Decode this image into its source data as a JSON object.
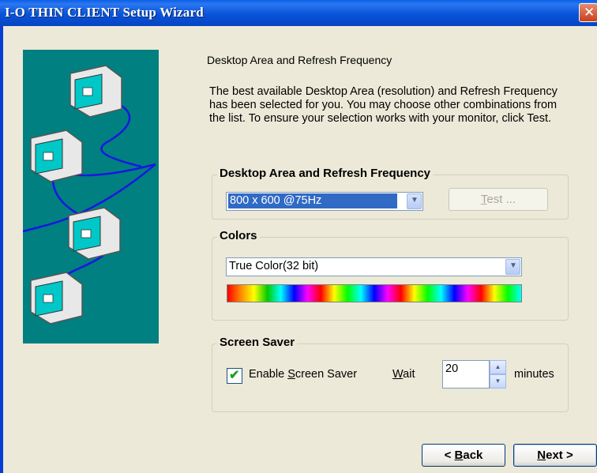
{
  "window": {
    "title": "I-O THIN CLIENT Setup Wizard",
    "close_glyph": "✕"
  },
  "page": {
    "heading": "Desktop Area and Refresh Frequency",
    "intro": "The best available Desktop Area (resolution) and Refresh Frequency has been selected for you.  You may choose other combinations from the list.  To ensure your selection works with your monitor, click Test."
  },
  "desktop_group": {
    "legend": "Desktop Area and Refresh Frequency",
    "selected": "800 x 600 @75Hz",
    "test_label_mnemonic": "T",
    "test_label_rest": "est ..."
  },
  "colors_group": {
    "legend": "Colors",
    "selected": "True Color(32 bit)"
  },
  "screensaver_group": {
    "legend": "Screen Saver",
    "enable_pre": "Enable ",
    "enable_mnemonic": "S",
    "enable_post": "creen Saver",
    "enabled": true,
    "wait_mnemonic": "W",
    "wait_rest": "ait",
    "wait_value": "20",
    "unit": "minutes"
  },
  "nav": {
    "back_pre": "< ",
    "back_mnemonic": "B",
    "back_rest": "ack",
    "next_mnemonic": "N",
    "next_rest": "ext >"
  },
  "icons": [
    "close-icon",
    "monitor-network-illustration",
    "chevron-down-icon",
    "checkmark-icon",
    "spin-up-icon",
    "spin-down-icon"
  ]
}
